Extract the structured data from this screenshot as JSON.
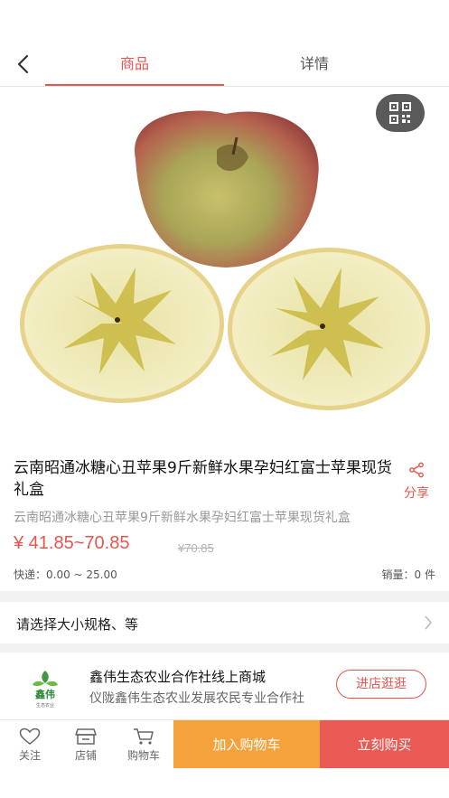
{
  "nav": {
    "tabs": [
      {
        "label": "商品",
        "active": true
      },
      {
        "label": "详情",
        "active": false
      }
    ]
  },
  "product": {
    "title": "云南昭通冰糖心丑苹果9斤新鲜水果孕妇红富士苹果现货礼盒",
    "subtitle": "云南昭通冰糖心丑苹果9斤新鲜水果孕妇红富士苹果现货礼盒",
    "price": "¥ 41.85~70.85",
    "original_price": "¥70.85",
    "shipping": "快递：0.00 ~ 25.00",
    "sales": "销量：0 件",
    "share_label": "分享"
  },
  "spec": {
    "label": "请选择大小规格、等"
  },
  "shop": {
    "name": "鑫伟生态农业合作社线上商城",
    "description": "仪陇鑫伟生态农业发展农民专业合作社",
    "visit_label": "进店逛逛",
    "logo_text": "鑫伟",
    "logo_subtext": "生态农业"
  },
  "bottom_bar": {
    "follow_label": "关注",
    "store_label": "店铺",
    "cart_label": "购物车",
    "add_cart_label": "加入购物车",
    "buy_now_label": "立刻购买"
  },
  "colors": {
    "accent": "#e8554e",
    "cart_button": "#f4a23c",
    "buy_button": "#ea5a55"
  }
}
